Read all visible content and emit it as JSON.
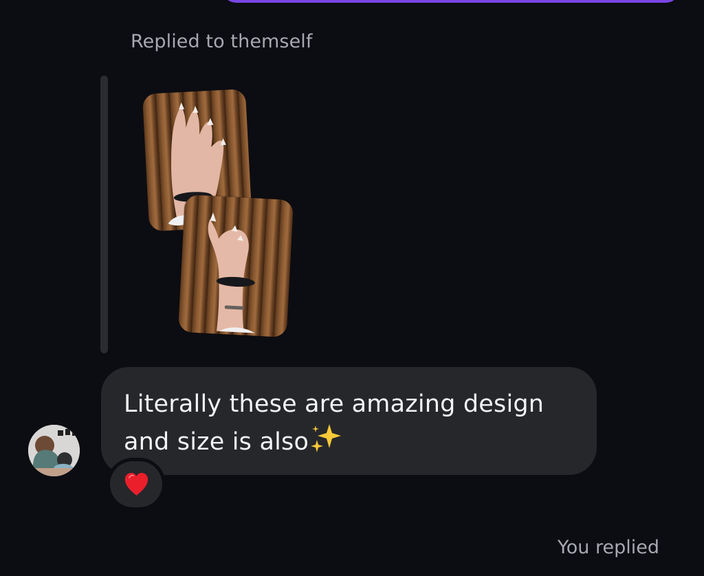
{
  "thread": {
    "reply_context": "Replied to themself",
    "message_text": "Literally these are amazing design and size is also",
    "message_emoji": "sparkles-emoji",
    "reaction": "red-heart-emoji",
    "footer_status": "You replied"
  },
  "colors": {
    "background": "#0c0d12",
    "bubble_incoming": "#26272b",
    "bubble_outgoing": "#7a45e3",
    "secondary_text": "#a7a9b0",
    "primary_text": "#f4f4f6"
  }
}
